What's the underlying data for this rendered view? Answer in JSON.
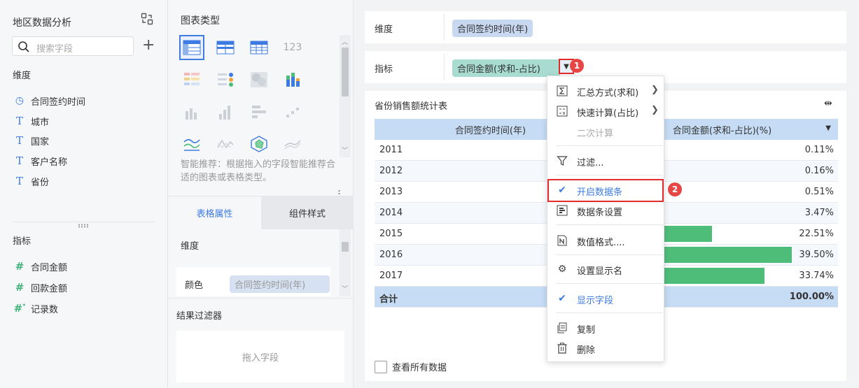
{
  "left_panel": {
    "title": "地区数据分析",
    "search_placeholder": "搜索字段",
    "dimension_label": "维度",
    "dimensions": [
      "合同签约时间",
      "城市",
      "国家",
      "客户名称",
      "省份"
    ],
    "metric_label": "指标",
    "metrics": [
      "合同金额",
      "回款金额",
      "记录数"
    ]
  },
  "mid_panel": {
    "chart_type_label": "图表类型",
    "hint": "智能推荐：根据拖入的字段智能推荐合适的图表或表格类型。",
    "tabs": [
      "表格属性",
      "组件样式"
    ],
    "dimension_label": "维度",
    "color_label": "颜色",
    "color_field": "合同签约时间(年)",
    "result_filter_label": "结果过滤器",
    "drop_placeholder": "拖入字段"
  },
  "config": {
    "dimension_label": "维度",
    "dimension_field": "合同签约时间(年)",
    "metric_label": "指标",
    "metric_field": "合同金额(求和-占比)",
    "dropdown_icon": "triangle-down-icon"
  },
  "table": {
    "title": "省份销售额统计表",
    "columns": [
      "合同签约时间(年)",
      "合同金额(求和-占比)(%)"
    ],
    "rows": [
      {
        "year": "2011",
        "value": "0.11%",
        "pct": 0.11
      },
      {
        "year": "2012",
        "value": "0.16%",
        "pct": 0.16
      },
      {
        "year": "2013",
        "value": "0.51%",
        "pct": 0.51
      },
      {
        "year": "2014",
        "value": "3.47%",
        "pct": 3.47
      },
      {
        "year": "2015",
        "value": "22.51%",
        "pct": 22.51
      },
      {
        "year": "2016",
        "value": "39.50%",
        "pct": 39.5
      },
      {
        "year": "2017",
        "value": "33.74%",
        "pct": 33.74
      }
    ],
    "total_label": "合计",
    "total_value": "100.00%",
    "bar_color": "#4fbd7a",
    "show_all_label": "查看所有数据"
  },
  "menu": {
    "items": [
      {
        "label": "汇总方式(求和)",
        "icon": "sigma-icon"
      },
      {
        "label": "快速计算(占比)",
        "icon": "calculator-icon"
      },
      {
        "label": "二次计算",
        "icon": ""
      },
      {
        "label": "过滤...",
        "icon": "filter-icon"
      },
      {
        "label": "开启数据条",
        "icon": "check-icon"
      },
      {
        "label": "数据条设置",
        "icon": "databar-settings-icon"
      },
      {
        "label": "数值格式....",
        "icon": "number-format-icon"
      },
      {
        "label": "设置显示名",
        "icon": "gear-icon"
      },
      {
        "label": "显示字段",
        "icon": "check-icon"
      },
      {
        "label": "复制",
        "icon": "copy-icon"
      },
      {
        "label": "删除",
        "icon": "trash-icon"
      }
    ]
  },
  "badges": [
    "1",
    "2"
  ],
  "accent_color": "#3d7be2",
  "highlight_color": "#e22b2b"
}
